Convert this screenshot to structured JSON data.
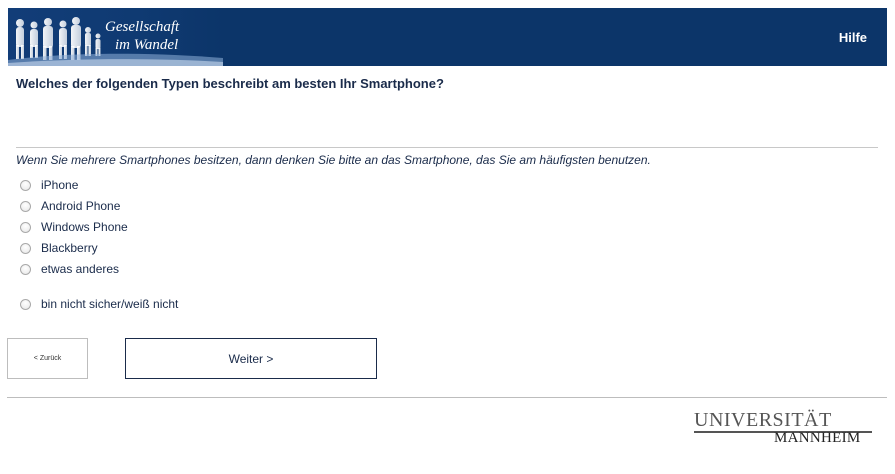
{
  "header": {
    "logo_line1": "Gesellschaft",
    "logo_line2": "im Wandel",
    "help_label": "Hilfe",
    "background_color": "#0c3569"
  },
  "question": {
    "title": "Welches der folgenden Typen beschreibt am besten Ihr Smartphone?",
    "hint": "Wenn Sie mehrere Smartphones besitzen, dann denken Sie bitte an das Smartphone, das Sie am häufigsten benutzen."
  },
  "options": [
    {
      "label": "iPhone",
      "selected": false
    },
    {
      "label": "Android Phone",
      "selected": false
    },
    {
      "label": "Windows Phone",
      "selected": false
    },
    {
      "label": "Blackberry",
      "selected": false
    },
    {
      "label": "etwas anderes",
      "selected": false
    },
    {
      "label": "bin nicht sicher/weiß nicht",
      "selected": false
    }
  ],
  "navigation": {
    "back_label": "< Zurück",
    "next_label": "Weiter >"
  },
  "footer": {
    "university_line1": "UNIVERSITÄT",
    "university_line2": "MANNHEIM"
  }
}
